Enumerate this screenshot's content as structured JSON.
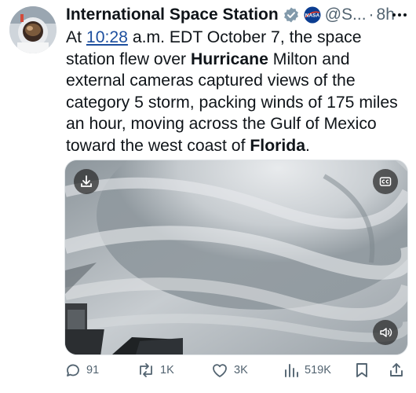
{
  "tweet": {
    "author_name": "International Space Station",
    "handle": "@S...",
    "separator": "·",
    "time": "8h",
    "text": {
      "p1": "At ",
      "link": "10:28",
      "p2": " a.m. EDT October 7, the space station flew over ",
      "b1": "Hurricane",
      "p3": " Milton and external cameras captured views of the category 5 storm, packing winds of 175 miles an hour, moving across the Gulf of Mexico toward the west coast of ",
      "b2": "Florida",
      "p4": "."
    },
    "org_badge_text": "NASA"
  },
  "actions": {
    "replies": "91",
    "retweets": "1K",
    "likes": "3K",
    "views": "519K"
  },
  "colors": {
    "verified": "#829aab",
    "link": "#1d4f9e",
    "icon_gray": "#536471"
  },
  "icons": [
    "more-icon",
    "verified-icon",
    "nasa-badge-icon",
    "download-icon",
    "captions-icon",
    "volume-icon",
    "reply-icon",
    "retweet-icon",
    "like-icon",
    "views-icon",
    "bookmark-icon",
    "share-icon"
  ]
}
